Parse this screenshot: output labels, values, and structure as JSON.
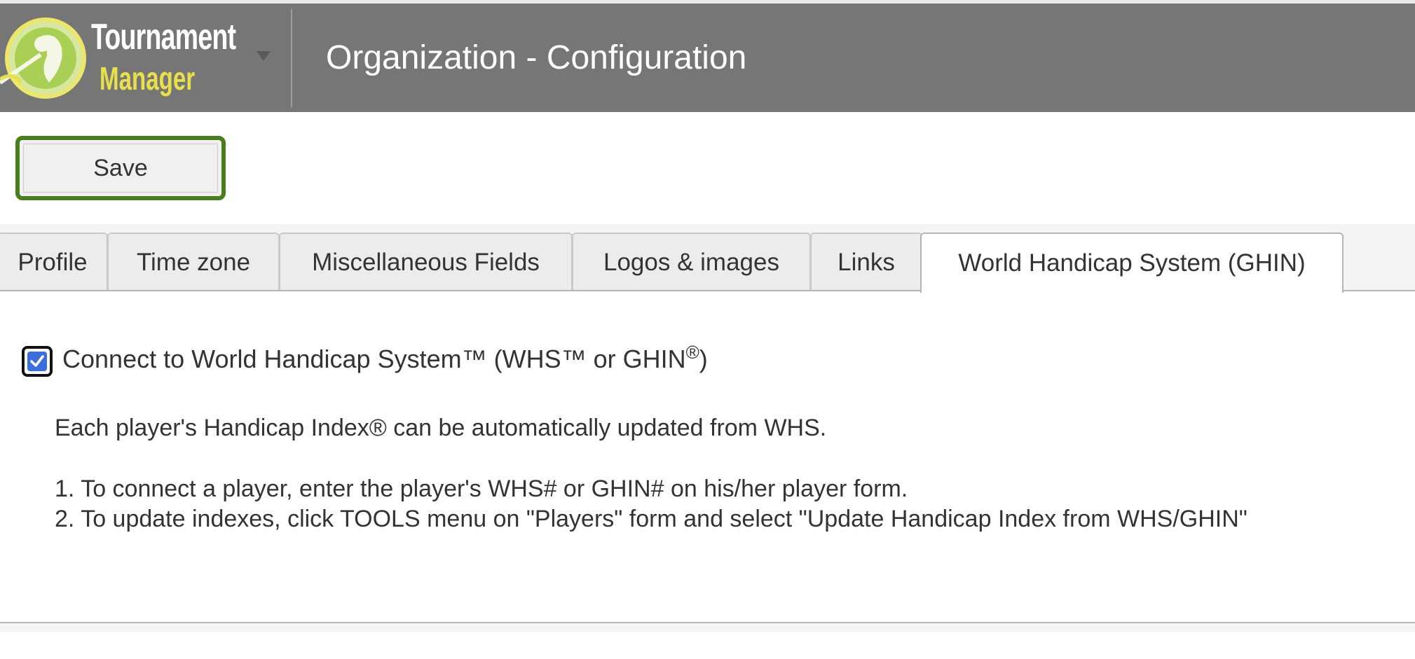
{
  "app": {
    "logo_line1": "Tournament",
    "logo_line2": "Manager",
    "page_title": "Organization - Configuration"
  },
  "toolbar": {
    "save_label": "Save"
  },
  "tabs": [
    {
      "label": "Profile",
      "active": false
    },
    {
      "label": "Time zone",
      "active": false
    },
    {
      "label": "Miscellaneous Fields",
      "active": false
    },
    {
      "label": "Logos & images",
      "active": false
    },
    {
      "label": "Links",
      "active": false
    },
    {
      "label": "World Handicap System (GHIN)",
      "active": true
    }
  ],
  "whs": {
    "checkbox_checked": true,
    "checkbox_label": "Connect to World Handicap System™ (WHS™ or GHIN",
    "checkbox_label_sup": "®",
    "checkbox_label_end": ")",
    "intro": "Each player's Handicap Index® can be automatically updated from WHS.",
    "step1": "1. To connect a player, enter the player's WHS# or GHIN# on his/her player form.",
    "step2": "2. To update indexes, click TOOLS menu on \"Players\" form and select \"Update Handicap Index from WHS/GHIN\""
  },
  "colors": {
    "header_bg": "#767676",
    "save_border": "#4a7d1c",
    "logo_yellow": "#e8e04a",
    "checkbox_blue": "#3b6fe0"
  },
  "icons": {
    "logo": "golfer-logo-icon",
    "caret": "caret-down-icon",
    "check": "checkmark-icon"
  }
}
